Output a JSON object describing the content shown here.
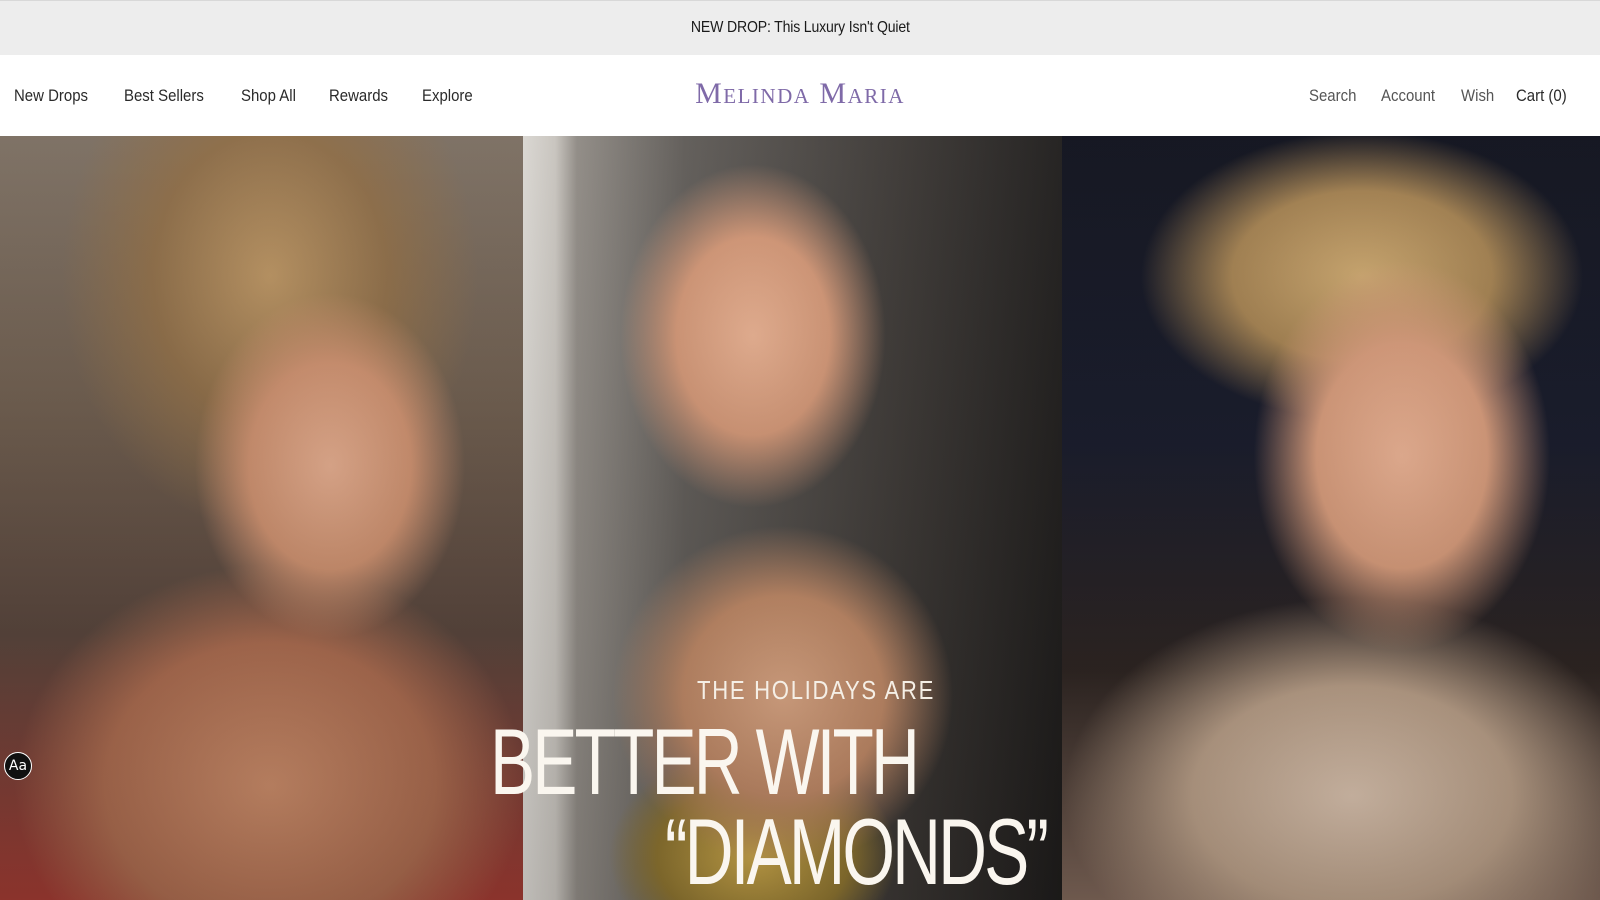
{
  "announcement": {
    "text": "NEW DROP: This Luxury Isn't Quiet"
  },
  "header": {
    "logo": "Melinda Maria",
    "nav_left": [
      {
        "label": "New Drops"
      },
      {
        "label": "Best Sellers"
      },
      {
        "label": "Shop All"
      },
      {
        "label": "Rewards"
      },
      {
        "label": "Explore"
      }
    ],
    "nav_right": {
      "search": "Search",
      "account": "Account",
      "wish": "Wish",
      "cart": "Cart (0)"
    }
  },
  "hero": {
    "eyebrow": "THE HOLIDAYS ARE",
    "headline_line1": "BETTER WITH",
    "headline_line2": "“DIAMONDS”"
  },
  "accessibility_badge": {
    "label": "Aa"
  },
  "colors": {
    "announcement_bg": "#ededed",
    "logo": "#7f6aa8",
    "hero_text": "#faf6ef"
  }
}
